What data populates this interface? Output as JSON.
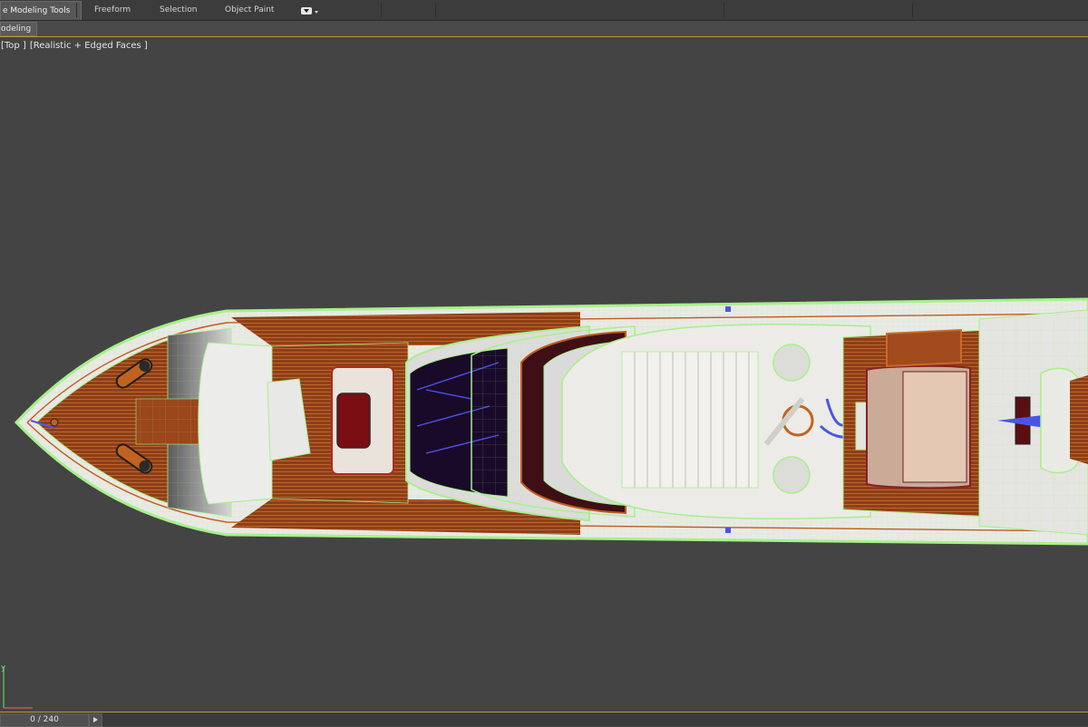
{
  "ribbon": {
    "tabs": [
      {
        "label": "e Modeling Tools"
      },
      {
        "label": "Freeform"
      },
      {
        "label": "Selection"
      },
      {
        "label": "Object Paint"
      }
    ],
    "panel_label": "odeling"
  },
  "viewport": {
    "view_name": "[Top ]",
    "shading_mode": "[Realistic + Edged Faces ]",
    "axis_label": "y"
  },
  "timeline": {
    "frame_counter": "0 / 240"
  },
  "colors": {
    "background": "#444444",
    "ribbon_accent": "#b99a36",
    "wire_green": "#a6f08a",
    "deck_wood": "#9a4a1e",
    "hull_white": "#e6e6e3"
  }
}
